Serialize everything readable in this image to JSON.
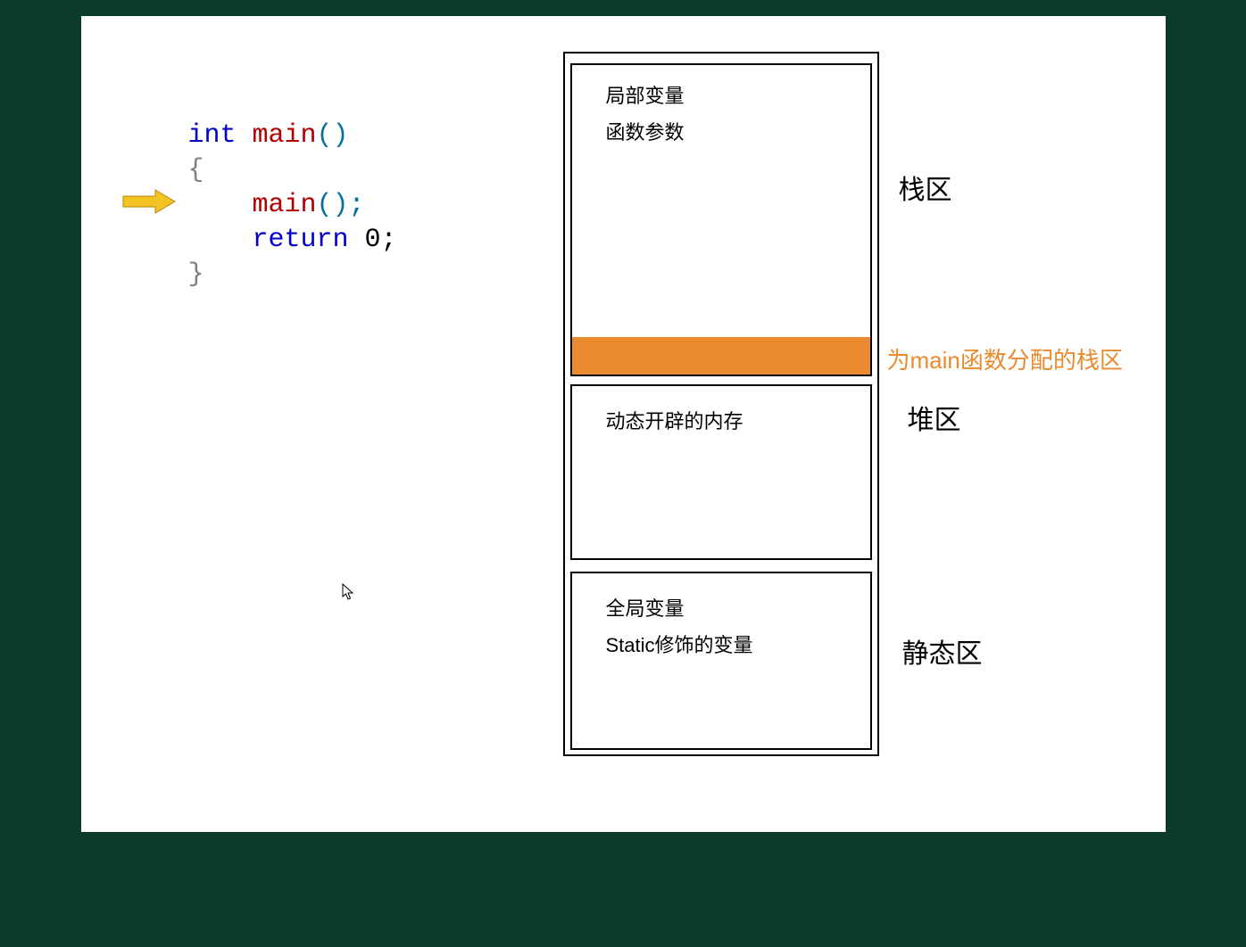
{
  "code": {
    "kw_int": "int",
    "fn_main": "main",
    "parens": "()",
    "open_brace": "{",
    "call_main": "main",
    "call_parens": "();",
    "kw_return": "return",
    "ret_val": " 0;",
    "close_brace": "}"
  },
  "stack": {
    "line1": "局部变量",
    "line2": "函数参数",
    "label": "栈区",
    "annotation": "为main函数分配的栈区"
  },
  "heap": {
    "line1": "动态开辟的内存",
    "label": "堆区"
  },
  "static": {
    "line1": "全局变量",
    "line2": "Static修饰的变量",
    "label": "静态区"
  },
  "colors": {
    "frame": "#e98a2e",
    "annotation": "#e98a2e"
  }
}
